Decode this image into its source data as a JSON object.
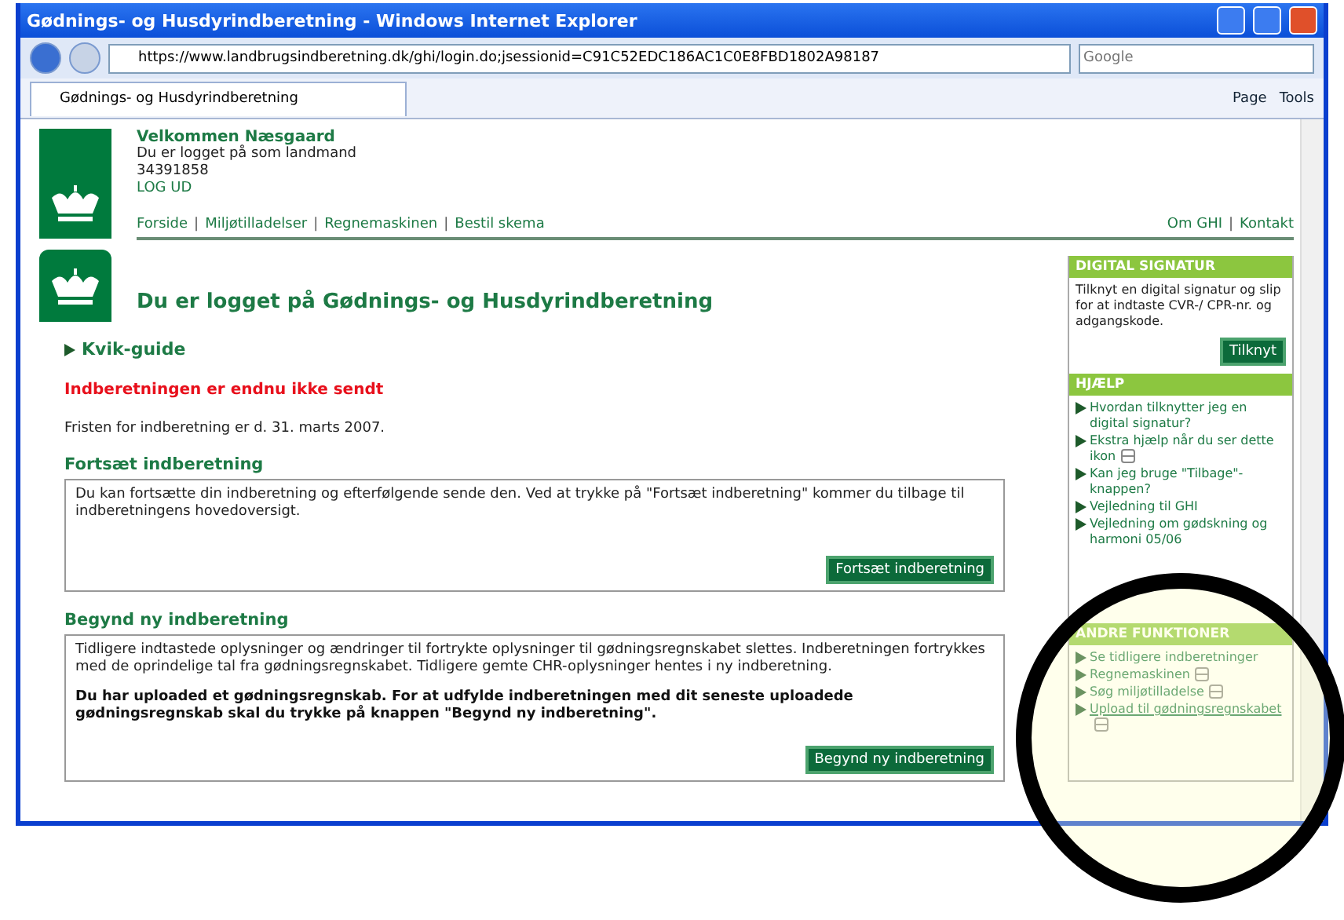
{
  "window": {
    "title": "Gødnings- og Husdyrindberetning - Windows Internet Explorer"
  },
  "address_bar": {
    "url": "https://www.landbrugsindberetning.dk/ghi/login.do;jsessionid=C91C52EDC186AC1C0E8FBD1802A98187",
    "search_placeholder": "Google"
  },
  "tab": {
    "label": "Gødnings- og Husdyrindberetning"
  },
  "command_bar": [
    "Page",
    "Tools"
  ],
  "header": {
    "welcome": "Velkommen Næsgaard",
    "role": "Du er logget på som landmand",
    "number": "34391858",
    "logout": "LOG UD",
    "nav": [
      "Forside",
      "Miljøtilladelser",
      "Regnemaskinen",
      "Bestil skema"
    ],
    "nav_right": [
      "Om GHI",
      "Kontakt"
    ],
    "separator": "|"
  },
  "main": {
    "heading": "Du er logget på Gødnings- og Husdyrindberetning",
    "quick_guide": "Kvik-guide",
    "warning": "Indberetningen er endnu ikke sendt",
    "deadline": "Fristen for indberetning er d. 31. marts 2007.",
    "sections": [
      {
        "title": "Fortsæt indberetning",
        "text": "Du kan fortsætte din indberetning og efterfølgende sende den. Ved at trykke på \"Fortsæt indberetning\" kommer du tilbage til indberetningens hovedoversigt.",
        "button": "Fortsæt indberetning"
      },
      {
        "title": "Begynd ny indberetning",
        "text": "Tidligere indtastede oplysninger og ændringer til fortrykte oplysninger til gødningsregnskabet slettes. Indberetningen fortrykkes med de oprindelige tal fra gødningsregnskabet. Tidligere gemte CHR-oplysninger hentes i ny indberetning.",
        "note": "Du har uploaded et gødningsregnskab. For at udfylde indberetningen med dit seneste uploadede gødningsregnskab skal du trykke på knappen \"Begynd ny indberetning\".",
        "button": "Begynd ny indberetning"
      }
    ]
  },
  "sidebar": [
    {
      "kind": "text",
      "title": "DIGITAL SIGNATUR",
      "text": "Tilknyt en digital signatur og slip for at indtaste CVR-/ CPR-nr. og adgangskode.",
      "button": "Tilknyt"
    },
    {
      "kind": "links",
      "title": "HJÆLP",
      "links": [
        {
          "label": "Hvordan tilknytter jeg en digital signatur?",
          "help": false,
          "underlined": false
        },
        {
          "label": "Ekstra hjælp når du ser dette ikon",
          "help": true,
          "underlined": false
        },
        {
          "label": "Kan jeg bruge \"Tilbage\"-knappen?",
          "help": false,
          "underlined": false
        },
        {
          "label": "Vejledning til GHI",
          "help": false,
          "underlined": false
        },
        {
          "label": "Vejledning om gødskning og harmoni 05/06",
          "help": false,
          "underlined": false
        }
      ]
    },
    {
      "kind": "links",
      "title": "ANDRE FUNKTIONER",
      "links": [
        {
          "label": "Se tidligere indberetninger",
          "help": false,
          "underlined": false
        },
        {
          "label": "Regnemaskinen",
          "help": true,
          "underlined": false
        },
        {
          "label": "Søg miljøtilladelse",
          "help": true,
          "underlined": false
        },
        {
          "label": "Upload til gødningsregnskabet",
          "help": true,
          "underlined": true
        }
      ]
    }
  ]
}
